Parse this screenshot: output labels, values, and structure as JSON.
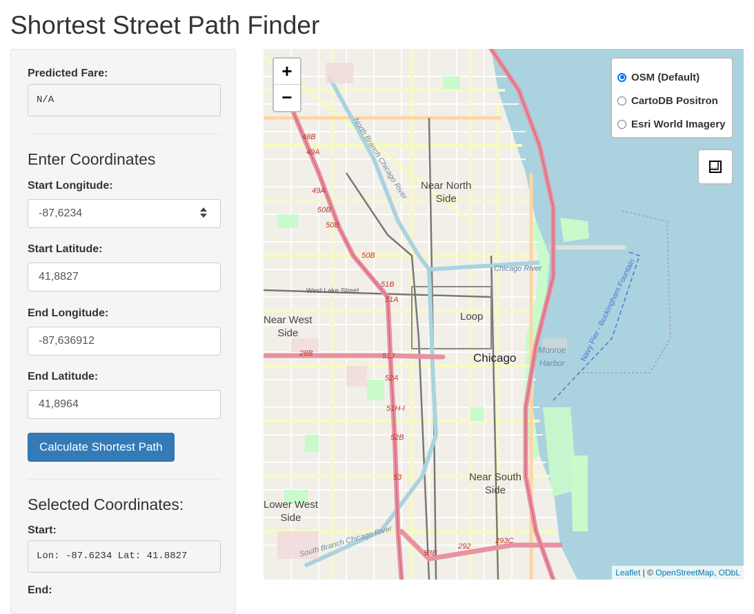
{
  "title": "Shortest Street Path Finder",
  "fare": {
    "label": "Predicted Fare:",
    "value": "N/A"
  },
  "coords": {
    "heading": "Enter Coordinates",
    "start_lon": {
      "label": "Start Longitude:",
      "value": "-87,6234"
    },
    "start_lat": {
      "label": "Start Latitude:",
      "value": "41,8827"
    },
    "end_lon": {
      "label": "End Longitude:",
      "value": "-87,636912"
    },
    "end_lat": {
      "label": "End Latitude:",
      "value": "41,8964"
    },
    "button": "Calculate Shortest Path"
  },
  "selected": {
    "heading": "Selected Coordinates:",
    "start_label": "Start:",
    "start_value": "Lon: -87.6234 Lat: 41.8827",
    "end_label": "End:"
  },
  "map": {
    "zoom_in": "+",
    "zoom_out": "−",
    "layers": [
      "OSM (Default)",
      "CartoDB Positron",
      "Esri World Imagery"
    ],
    "selected_layer": "OSM (Default)",
    "attribution": {
      "leaflet": "Leaflet",
      "sep": " | © ",
      "osm": "OpenStreetMap",
      "comma": ", ",
      "odbl": "ODbL"
    },
    "labels": {
      "near_north": "Near North\nSide",
      "loop": "Loop",
      "chicago": "Chicago",
      "near_west": "Near West\nSide",
      "near_south": "Near South\nSide",
      "lower_west": "Lower West\nSide",
      "monroe": "Monroe\nHarbor",
      "chicago_river": "Chicago River",
      "west_lake": "West Lake Street",
      "navy_pier": "Navy Pier - Buckingham Fountain",
      "north_branch": "North Branch Chicago River",
      "south_branch": "South Branch Chicago River"
    },
    "exits": [
      "48B",
      "49A",
      "49A",
      "49B",
      "50B",
      "50B",
      "51B",
      "51A",
      "51B",
      "51F",
      "51G",
      "51I",
      "51J",
      "28B",
      "52A",
      "51H-I",
      "52B",
      "52C",
      "53",
      "53A",
      "53B",
      "292",
      "292B",
      "293C"
    ]
  },
  "colors": {
    "accent": "#337ab7",
    "water": "#aad3df",
    "motorway": "#e892a2",
    "primary": "#fcd6a4",
    "secondary": "#f7fabf",
    "park": "#c8facc"
  }
}
